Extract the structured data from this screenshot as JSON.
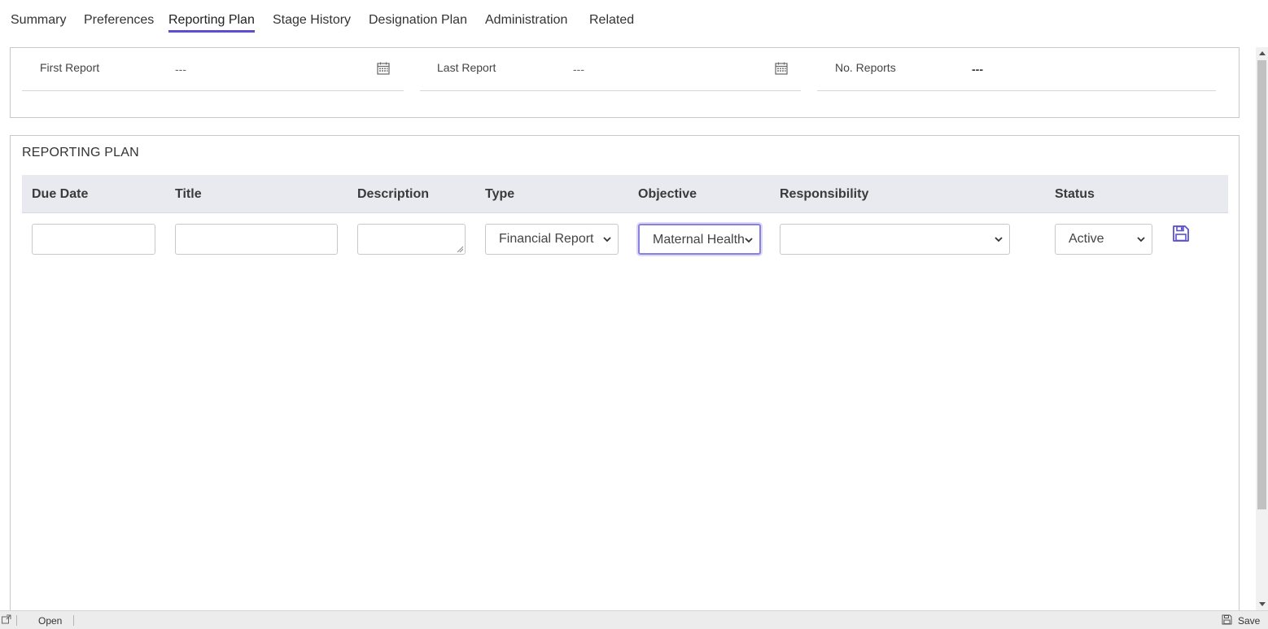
{
  "tabs": [
    {
      "label": "Summary"
    },
    {
      "label": "Preferences"
    },
    {
      "label": "Reporting Plan",
      "active": true
    },
    {
      "label": "Stage History"
    },
    {
      "label": "Designation Plan"
    },
    {
      "label": "Administration"
    },
    {
      "label": "Related"
    }
  ],
  "summary_fields": {
    "first_report": {
      "label": "First Report",
      "value": "---"
    },
    "last_report": {
      "label": "Last Report",
      "value": "---"
    },
    "no_reports": {
      "label": "No. Reports",
      "value": "---"
    }
  },
  "reporting_plan": {
    "title": "REPORTING PLAN",
    "columns": [
      "Due Date",
      "Title",
      "Description",
      "Type",
      "Objective",
      "Responsibility",
      "Status"
    ],
    "new_row": {
      "due_date": "",
      "title": "",
      "description": "",
      "type": "Financial Report",
      "objective": "Maternal Health",
      "responsibility": "",
      "status": "Active"
    }
  },
  "statusbar": {
    "open_label": "Open",
    "save_label": "Save"
  },
  "colors": {
    "accent": "#5b4fd0",
    "header_bg": "#e9eaef"
  }
}
